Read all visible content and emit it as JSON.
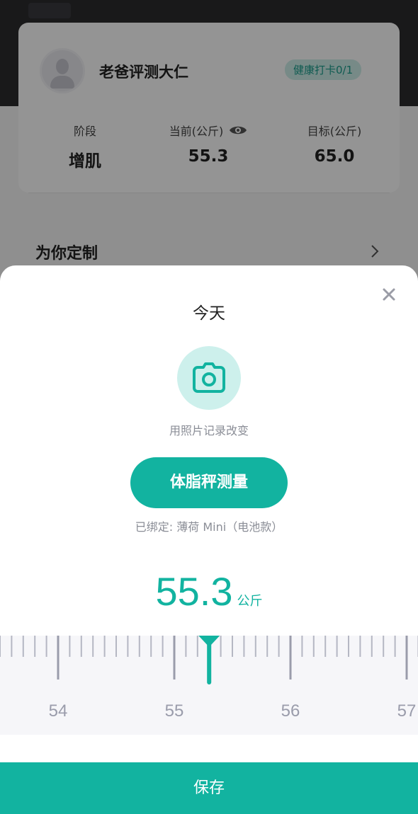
{
  "profile": {
    "username": "老爸评测大仁",
    "checkin_badge": "健康打卡0/1"
  },
  "stats": [
    {
      "label": "阶段",
      "value": "增肌"
    },
    {
      "label": "当前(公斤)",
      "value": "55.3"
    },
    {
      "label": "目标(公斤)",
      "value": "65.0"
    }
  ],
  "custom_section": {
    "title": "为你定制"
  },
  "sheet": {
    "title": "今天",
    "photo_hint": "用照片记录改变",
    "measure_button": "体脂秤测量",
    "bound_device": "已绑定: 薄荷 Mini（电池款）",
    "weight_value": "55.3",
    "weight_unit": "公斤",
    "save_button": "保存"
  },
  "ruler": {
    "labels": [
      "54",
      "55",
      "56",
      "57"
    ],
    "current_value": 55.3
  },
  "colors": {
    "accent": "#12b3a0",
    "accent_light": "#cdf0ec"
  }
}
